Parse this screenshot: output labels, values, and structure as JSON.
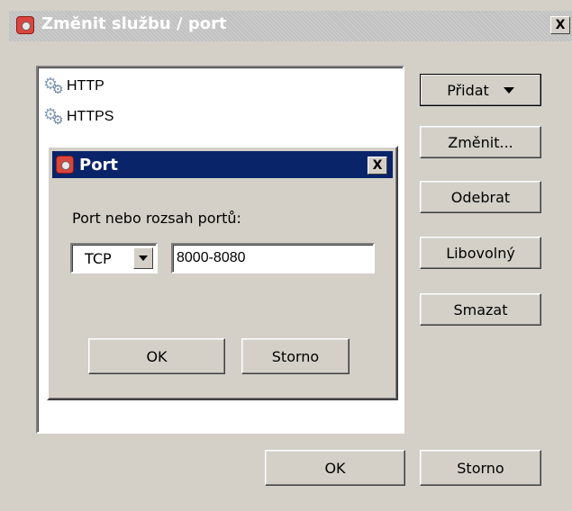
{
  "main_window": {
    "title": "Změnit službu / port",
    "close_label": "X",
    "services": [
      {
        "label": "HTTP",
        "icon": "gears-icon"
      },
      {
        "label": "HTTPS",
        "icon": "gears-icon"
      }
    ],
    "buttons": {
      "add": "Přidat",
      "edit": "Změnit...",
      "remove": "Odebrat",
      "any": "Libovolný",
      "clear": "Smazat",
      "ok": "OK",
      "cancel": "Storno"
    }
  },
  "port_dialog": {
    "title": "Port",
    "close_label": "X",
    "label": "Port nebo rozsah portů:",
    "protocol_value": "TCP",
    "port_value": "8000-8080",
    "ok": "OK",
    "cancel": "Storno"
  },
  "colors": {
    "dialog_titlebar": "#0a246a",
    "window_face": "#d4d0c8",
    "app_icon": "#d9463f"
  }
}
